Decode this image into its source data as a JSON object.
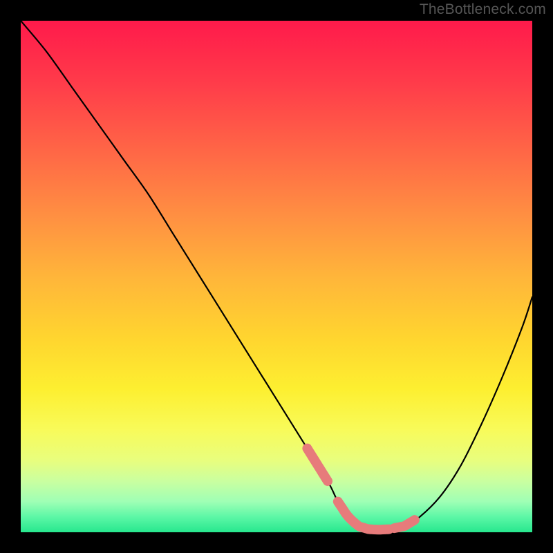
{
  "watermark": "TheBottleneck.com",
  "colors": {
    "pink_marker": "#e77b7b",
    "curve": "#000000"
  },
  "chart_data": {
    "type": "line",
    "title": "",
    "xlabel": "",
    "ylabel": "",
    "xlim": [
      0,
      100
    ],
    "ylim": [
      0,
      100
    ],
    "grid": false,
    "legend": false,
    "series": [
      {
        "name": "bottleneck-curve",
        "x": [
          0,
          5,
          10,
          15,
          20,
          25,
          30,
          35,
          40,
          45,
          50,
          55,
          60,
          62,
          64,
          66,
          68,
          70,
          72,
          75,
          78,
          82,
          86,
          90,
          94,
          98,
          100
        ],
        "y": [
          100,
          94,
          87,
          80,
          73,
          66,
          58,
          50,
          42,
          34,
          26,
          18,
          10,
          6,
          3,
          1.2,
          0.6,
          0.5,
          0.6,
          1.2,
          3,
          7,
          13,
          21,
          30,
          40,
          46
        ]
      }
    ],
    "annotations": [
      {
        "name": "highlight-left-descent",
        "x_range": [
          56,
          60
        ],
        "style": "pink-thick"
      },
      {
        "name": "highlight-valley-floor",
        "x_range": [
          62,
          72
        ],
        "style": "pink-thick"
      },
      {
        "name": "highlight-right-ascent",
        "x_range": [
          73,
          77
        ],
        "style": "pink-thick"
      }
    ]
  }
}
